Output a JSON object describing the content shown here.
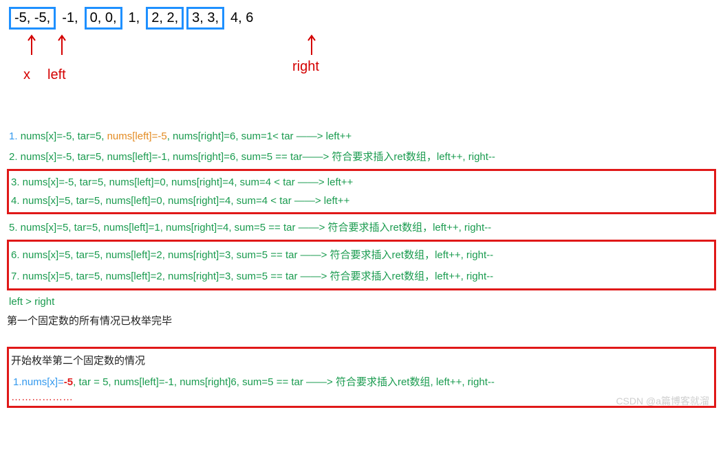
{
  "array": {
    "items": [
      "-5,  -5,",
      "-1,",
      "0,  0,",
      "1,",
      "2,  2,",
      "3,  3,",
      "4,  6"
    ],
    "boxes": [
      true,
      false,
      true,
      false,
      true,
      true,
      false
    ]
  },
  "pointers": {
    "x": "x",
    "left": "left",
    "right": "right"
  },
  "steps": {
    "s1": "1. nums[x]=-5, tar=5, nums[left]=-5, nums[right]=6, sum=1< tar ——> left++",
    "s2": "2. nums[x]=-5, tar=5, nums[left]=-1, nums[right]=6, sum=5 == tar——> 符合要求插入ret数组，left++, right--",
    "s3": "3. nums[x]=-5, tar=5, nums[left]=0,  nums[right]=4, sum=4 < tar ——> left++",
    "s4": " 4. nums[x]=5, tar=5, nums[left]=0,  nums[right]=4, sum=4 < tar ——> left++",
    "s5": "5. nums[x]=5, tar=5,  nums[left]=1,  nums[right]=4, sum=5 == tar ——> 符合要求插入ret数组，left++, right--",
    "s6": "6. nums[x]=5, tar=5,  nums[left]=2,  nums[right]=3, sum=5 == tar ——> 符合要求插入ret数组，left++, right--",
    "s7": "7. nums[x]=5, tar=5,  nums[left]=2,  nums[right]=3, sum=5 == tar ——> 符合要求插入ret数组，left++, right--",
    "s8": "left > right",
    "summary1": "第一个固定数的所有情况已枚举完毕",
    "section2_title": "开始枚举第二个固定数的情况",
    "s2_1_p1": "1.nums[x]=",
    "s2_1_val": "-5",
    "s2_1_p2": ", tar = 5, nums[left]=-1, nums[right]6, sum=5 == tar ——> 符合要求插入ret数组, left++, right--",
    "dots": "………………"
  },
  "watermark": "CSDN @a篇博客就溜"
}
